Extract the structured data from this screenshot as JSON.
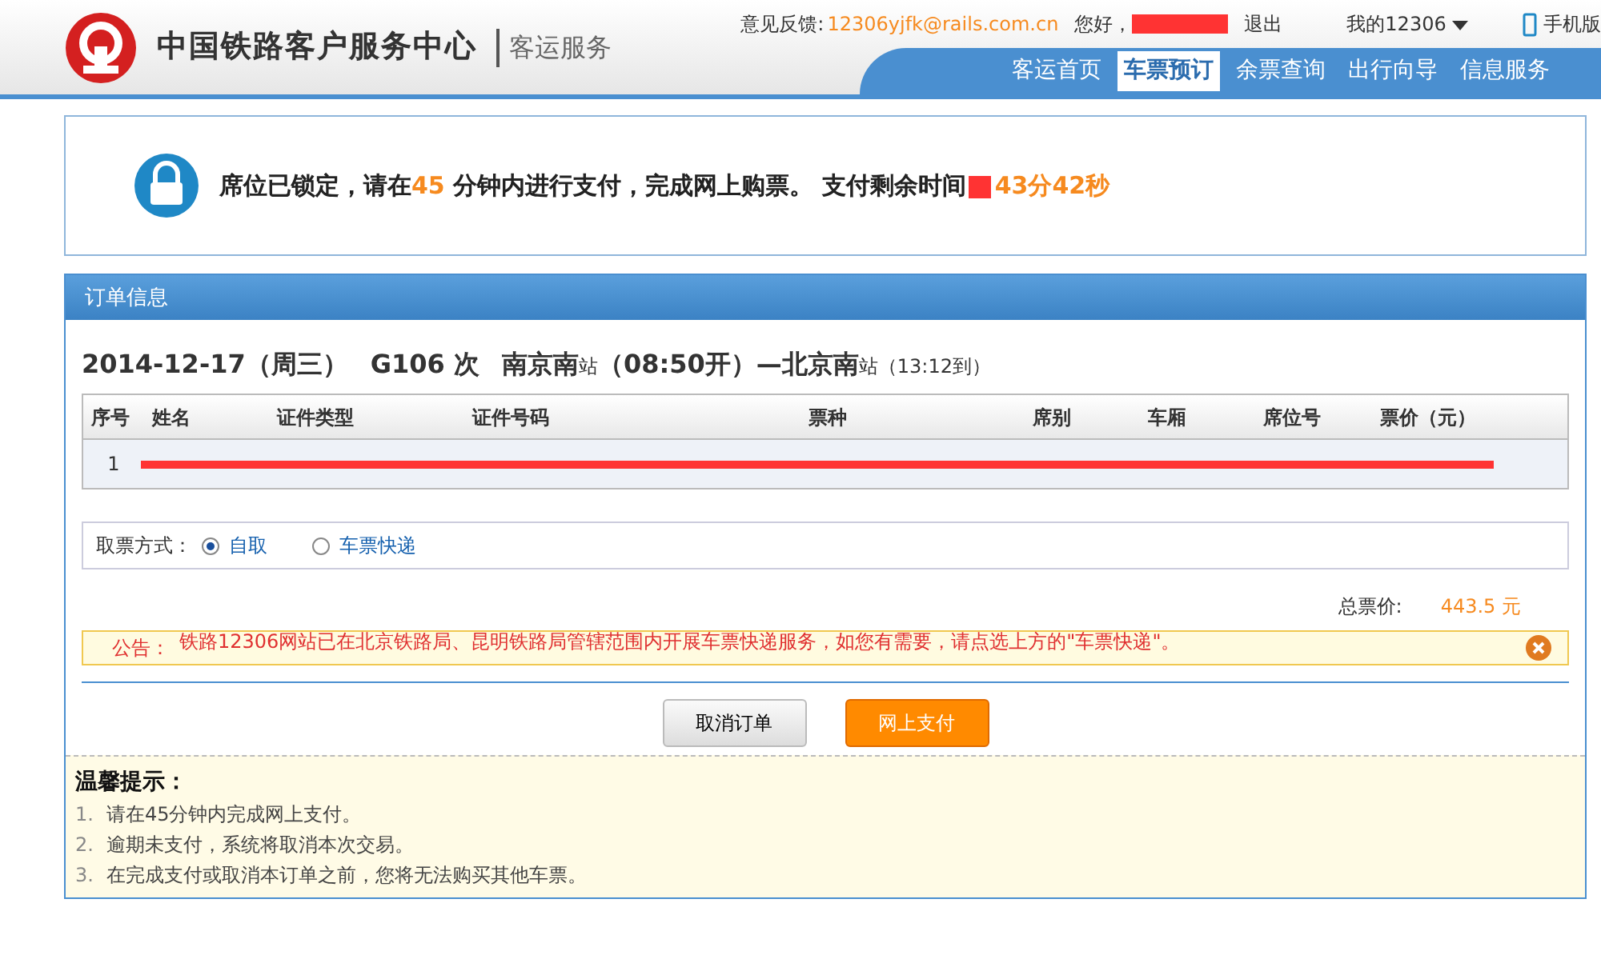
{
  "header": {
    "logo_title": "中国铁路客户服务中心",
    "subtitle": "客运服务",
    "feedback_label": "意见反馈:",
    "feedback_email": "12306yjfk@rails.com.cn",
    "greeting": "您好，",
    "greeting_redacted": true,
    "logout": "退出",
    "my_account": "我的12306",
    "mobile": "手机版",
    "nav": [
      {
        "label": "客运首页",
        "selected": false
      },
      {
        "label": "车票预订",
        "selected": true
      },
      {
        "label": "余票查询",
        "selected": false
      },
      {
        "label": "出行向导",
        "selected": false
      },
      {
        "label": "信息服务",
        "selected": false
      }
    ]
  },
  "lock_message": {
    "before": "席位已锁定，请在",
    "minutes": "45",
    "after": "分钟内进行支付，完成网上购票。 支付剩余时间",
    "redacted": true,
    "countdown": "43分42秒"
  },
  "order": {
    "panel_title": "订单信息",
    "date": "2014-12-17（周三）",
    "train": "G106 次",
    "from": "南京南",
    "from_suffix": "站",
    "depart": "（08:50开）—",
    "to": "北京南",
    "to_suffix": "站",
    "arrive": "（13:12到）",
    "table": {
      "columns": [
        "序号",
        "姓名",
        "证件类型",
        "证件号码",
        "票种",
        "席别",
        "车厢",
        "席位号",
        "票价（元）"
      ],
      "rows": [
        {
          "cells": [
            "1"
          ],
          "redacted": true
        }
      ]
    },
    "pickup": {
      "label": "取票方式：",
      "options": [
        {
          "label": "自取",
          "selected": true
        },
        {
          "label": "车票快递",
          "selected": false
        }
      ]
    },
    "total_label": "总票价:",
    "total": "443.5 元",
    "notice": {
      "label": "公告：",
      "text": "铁路12306网站已在北京铁路局、昆明铁路局管辖范围内开展车票快递服务，如您有需要，请点选上方的\"车票快递\"。"
    },
    "buttons": [
      {
        "label": "取消订单",
        "kind": "secondary"
      },
      {
        "label": "网上支付",
        "kind": "primary"
      }
    ]
  },
  "tips": {
    "title": "温馨提示：",
    "items": [
      {
        "number": "1.",
        "text": "请在45分钟内完成网上支付。"
      },
      {
        "number": "2.",
        "text": "逾期未支付，系统将取消本次交易。"
      },
      {
        "number": "3.",
        "text": "在完成支付或取消本订单之前，您将无法购买其他车票。"
      }
    ]
  }
}
